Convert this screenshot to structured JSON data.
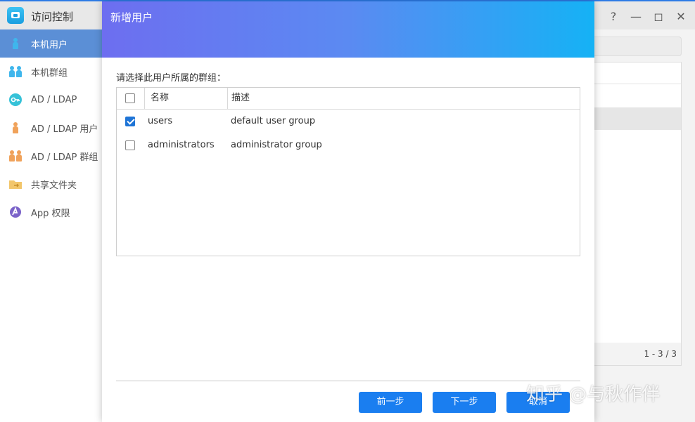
{
  "app": {
    "title": "访问控制"
  },
  "window_controls": {
    "help": "?",
    "minimize": "—",
    "maximize": "◻",
    "close": "✕"
  },
  "sidebar": {
    "items": [
      {
        "label": "本机用户",
        "icon": "user-icon",
        "active": true
      },
      {
        "label": "本机群组",
        "icon": "group-icon",
        "active": false
      },
      {
        "label": "AD / LDAP",
        "icon": "key-icon",
        "active": false
      },
      {
        "label": "AD / LDAP 用户",
        "icon": "ad-user-icon",
        "active": false
      },
      {
        "label": "AD / LDAP 群组",
        "icon": "ad-group-icon",
        "active": false
      },
      {
        "label": "共享文件夹",
        "icon": "folder-icon",
        "active": false
      },
      {
        "label": "App 权限",
        "icon": "app-permission-icon",
        "active": false
      }
    ]
  },
  "background_table": {
    "pager": "1 - 3 / 3"
  },
  "modal": {
    "title": "新增用户",
    "instruction": "请选择此用户所属的群组：",
    "columns": {
      "name": "名称",
      "description": "描述"
    },
    "rows": [
      {
        "name": "users",
        "description": "default user group",
        "checked": true
      },
      {
        "name": "administrators",
        "description": "administrator group",
        "checked": false
      }
    ],
    "buttons": {
      "prev": "前一步",
      "next": "下一步",
      "cancel": "取消"
    }
  },
  "watermark": "知乎 @与秋作伴",
  "colors": {
    "accent": "#1a7ef0",
    "sidebar_active": "#5b8fd6",
    "header_start": "#6d6ef0",
    "header_end": "#15b2f5"
  }
}
